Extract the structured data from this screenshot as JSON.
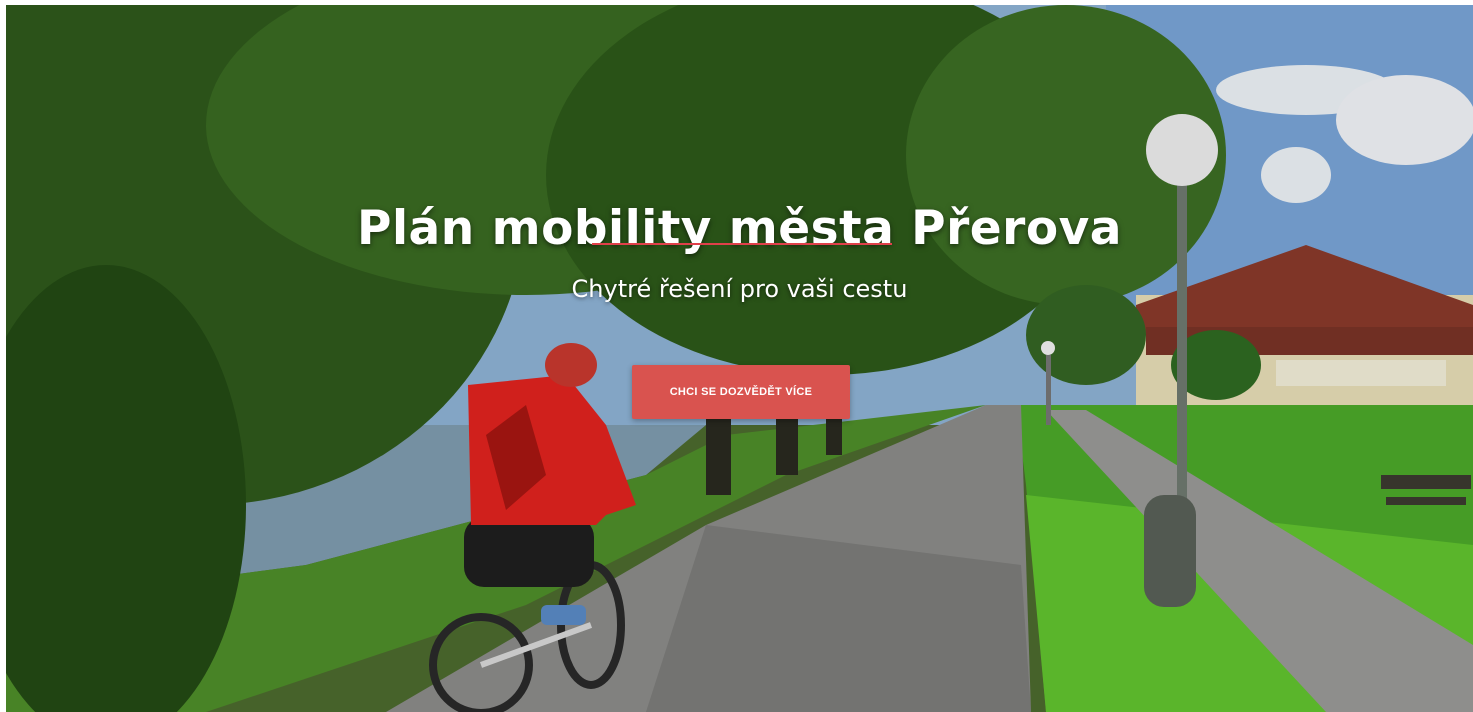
{
  "hero": {
    "title": "Plán mobility města Přerova",
    "subtitle": "Chytré řešení pro vaši cestu",
    "cta_label": "CHCI SE DOZVĚDĚT VÍCE"
  },
  "colors": {
    "accent": "#d9534f",
    "divider": "#e0404a",
    "text": "#ffffff"
  }
}
